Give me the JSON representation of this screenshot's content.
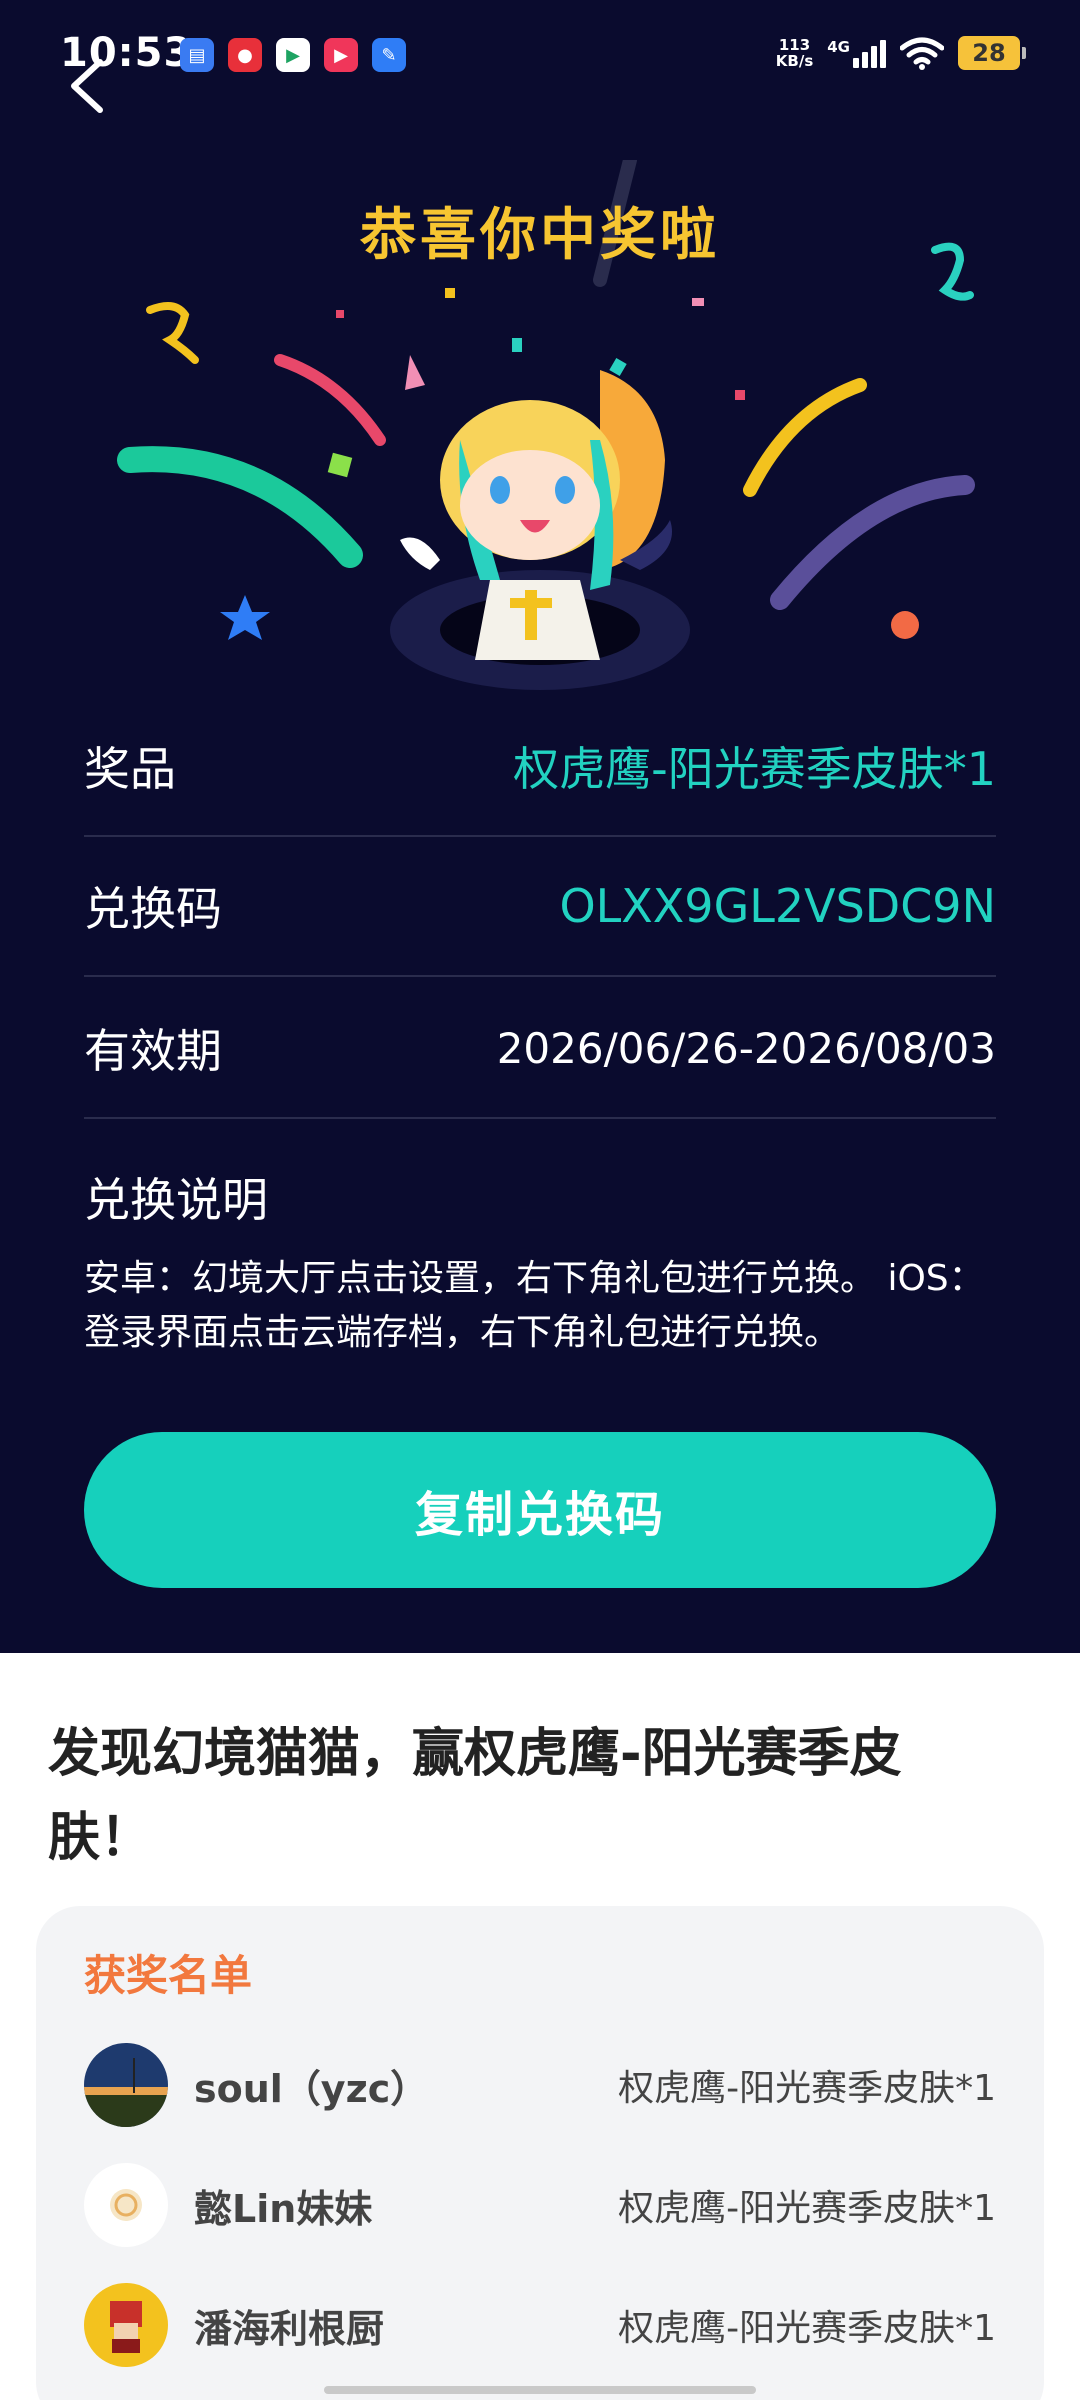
{
  "status_bar": {
    "time": "10:53",
    "net_speed_value": "113",
    "net_speed_unit": "KB/s",
    "network_type": "4G",
    "battery_level": "28",
    "app_icons": [
      "files-app-icon",
      "jd-app-icon",
      "play-store-icon",
      "video-app-icon",
      "feather-app-icon"
    ]
  },
  "header": {
    "congrats_title": "恭喜你中奖啦"
  },
  "prize_info": {
    "prize_label": "奖品",
    "prize_value": "权虎鹰-阳光赛季皮肤*1",
    "code_label": "兑换码",
    "code_value": "OLXX9GL2VSDC9N",
    "validity_label": "有效期",
    "validity_value": "2026/06/26-2026/08/03",
    "instructions_label": "兑换说明",
    "instructions_line1": "安卓：幻境大厅点击设置，右下角礼包进行兑换。 iOS：",
    "instructions_line2": "登录界面点击云端存档，右下角礼包进行兑换。"
  },
  "copy_button_label": "复制兑换码",
  "promo": {
    "line1": "发现幻境猫猫，赢权虎鹰-阳光赛季皮",
    "line2": "肤！"
  },
  "winners": {
    "title": "获奖名单",
    "list": [
      {
        "name": "soul（yzc）",
        "prize": "权虎鹰-阳光赛季皮肤*1"
      },
      {
        "name": "懿Lin妹妹",
        "prize": "权虎鹰-阳光赛季皮肤*1"
      },
      {
        "name": "潘海利根厨",
        "prize": "权虎鹰-阳光赛季皮肤*1"
      }
    ]
  },
  "colors": {
    "background_dark": "#0a0b2e",
    "accent_teal": "#16d0bc",
    "title_gold": "#f7c531",
    "winners_title_orange": "#f2783e"
  }
}
